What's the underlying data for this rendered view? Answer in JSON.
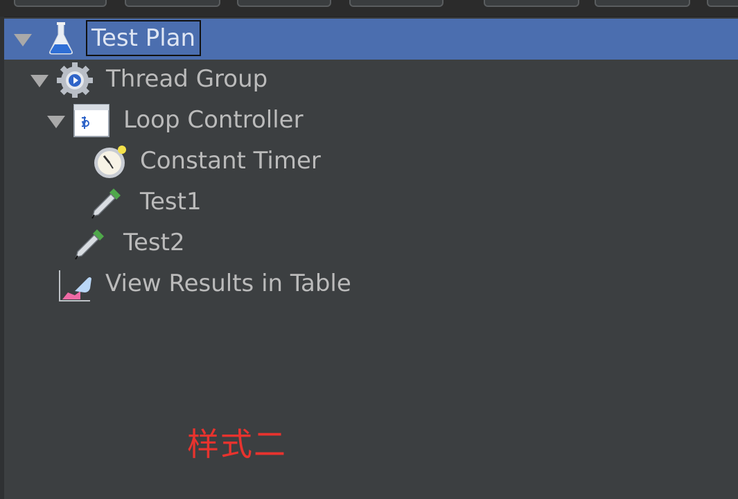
{
  "tree": {
    "items": [
      {
        "label": "Test Plan",
        "icon": "flask-icon",
        "expanded": true,
        "selected": true
      },
      {
        "label": "Thread Group",
        "icon": "gear-icon",
        "expanded": true
      },
      {
        "label": "Loop Controller",
        "icon": "loop-controller-icon",
        "expanded": true
      },
      {
        "label": "Constant Timer",
        "icon": "timer-icon"
      },
      {
        "label": "Test1",
        "icon": "sampler-pipette-icon"
      },
      {
        "label": "Test2",
        "icon": "sampler-pipette-icon"
      },
      {
        "label": "View Results in Table",
        "icon": "results-table-icon"
      }
    ]
  },
  "annotation": {
    "text": "样式二",
    "color": "#e8332e"
  },
  "colors": {
    "background": "#3c3f41",
    "selection": "#4b6eaf",
    "text": "#bbbbbb"
  }
}
